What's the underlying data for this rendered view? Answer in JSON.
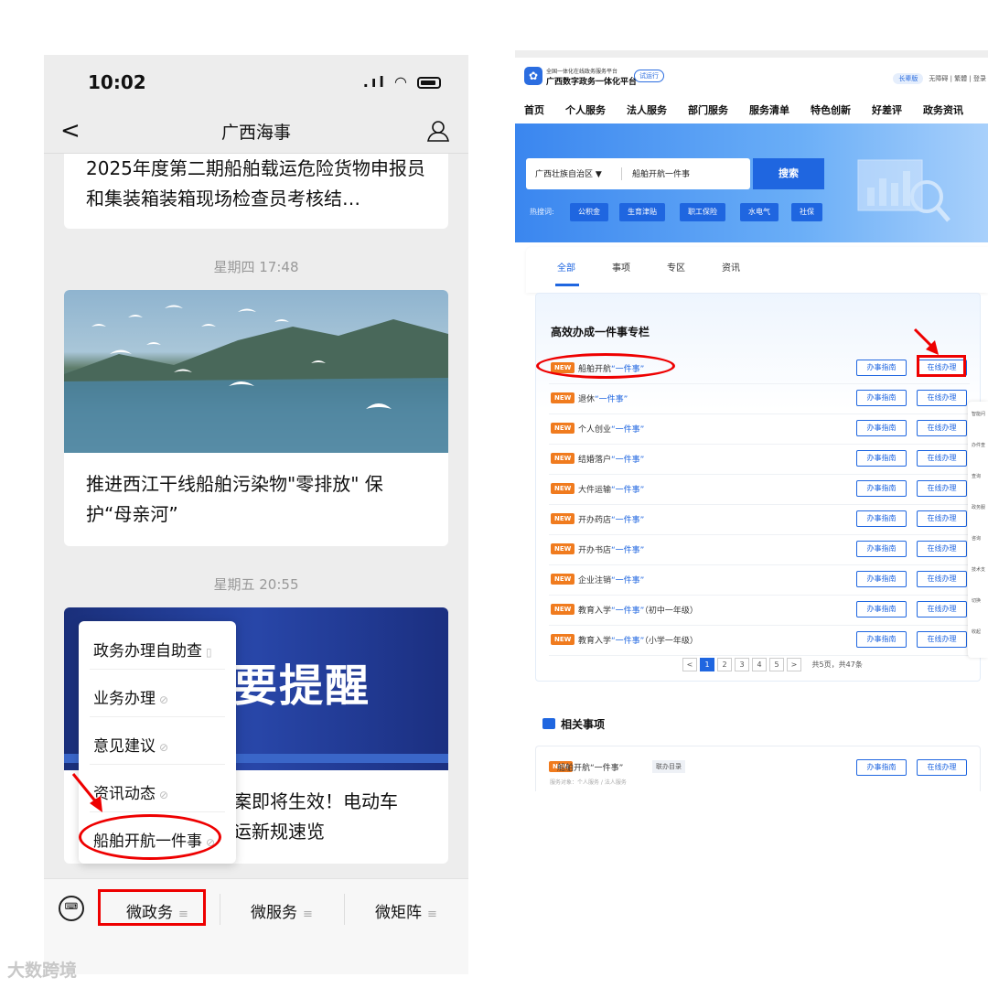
{
  "phone": {
    "status": {
      "time": "10:02",
      "icons": "..!!"
    },
    "nav": {
      "back": "<",
      "title": "广西海事"
    },
    "card1": {
      "title": "2025年度第二期船舶载运危险货物申报员和集装箱装箱现场检查员考核结…"
    },
    "time1": "星期四 17:48",
    "card2": {
      "title": "推进西江干线船舶污染物\"零排放\"  保护“母亲河”"
    },
    "time2": "星期五 20:55",
    "card3": {
      "banner": "要提醒",
      "title": "案即将生效！电动车\n运新规速览"
    },
    "popup": [
      {
        "label": "政务办理自助查"
      },
      {
        "label": "业务办理"
      },
      {
        "label": "意见建议"
      },
      {
        "label": "资讯动态"
      },
      {
        "label": "船舶开航一件事"
      }
    ],
    "bottom_menu": [
      {
        "label": "微政务"
      },
      {
        "label": "微服务"
      },
      {
        "label": "微矩阵"
      }
    ]
  },
  "web": {
    "header": {
      "subtitle": "全国一体化在线政务服务平台",
      "name": "广西数字政务一体化平台",
      "trial": "试运行",
      "elder": "长辈版",
      "access": "无障碍 | 繁體 | 登录"
    },
    "nav": [
      "首页",
      "个人服务",
      "法人服务",
      "部门服务",
      "服务清单",
      "特色创新",
      "好差评",
      "政务资讯"
    ],
    "search": {
      "region": "广西壮族自治区 ▼",
      "value": "船舶开航一件事",
      "button": "搜索",
      "hot_label": "热搜词:",
      "hot": [
        "公积金",
        "生育津贴",
        "职工保险",
        "水电气",
        "社保"
      ]
    },
    "tabs": [
      "全部",
      "事项",
      "专区",
      "资讯"
    ],
    "section": {
      "title": "高效办成一件事专栏",
      "new_badge": "NEW",
      "guide_label": "办事指南",
      "online_label": "在线办理",
      "rows": [
        {
          "pre": "船舶开航",
          "hl": "“一件事”",
          "post": ""
        },
        {
          "pre": "退休",
          "hl": "“一件事”",
          "post": ""
        },
        {
          "pre": "个人创业",
          "hl": "“一件事”",
          "post": ""
        },
        {
          "pre": "结婚落户",
          "hl": "“一件事”",
          "post": ""
        },
        {
          "pre": "大件运输",
          "hl": "“一件事”",
          "post": ""
        },
        {
          "pre": "开办药店",
          "hl": "“一件事”",
          "post": ""
        },
        {
          "pre": "开办书店",
          "hl": "“一件事”",
          "post": ""
        },
        {
          "pre": "企业注销",
          "hl": "“一件事”",
          "post": ""
        },
        {
          "pre": "教育入学",
          "hl": "“一件事”",
          "post": "（初中一年级）"
        },
        {
          "pre": "教育入学",
          "hl": "“一件事”",
          "post": "（小学一年级）"
        }
      ],
      "pager": {
        "prev": "<",
        "pages": [
          "1",
          "2",
          "3",
          "4",
          "5"
        ],
        "next": ">",
        "summary": "共5页，共47条"
      }
    },
    "related": {
      "title": "相关事项",
      "name": "船舶开航“一件事”",
      "tag": "联办目录",
      "sub": "服务对象：个人服务 / 法人服务",
      "guide": "办事指南",
      "online": "在线办理"
    },
    "side": [
      "智能问",
      "办件查",
      "查询",
      "政务服",
      "咨询",
      "技术支",
      "切换",
      "收起"
    ]
  },
  "watermark": "大数跨境",
  "colors": {
    "annotation": "#e00000",
    "brand_blue": "#1f66e0",
    "new_orange": "#f07b1e"
  }
}
